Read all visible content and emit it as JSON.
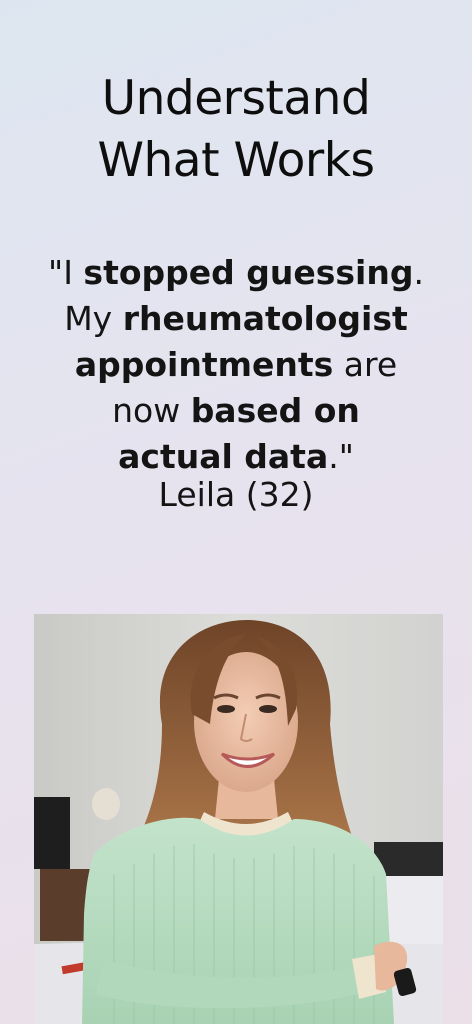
{
  "headline": {
    "line1": "Understand",
    "line2": "What Works"
  },
  "testimonial": {
    "l1_a": "\"I ",
    "l1_b": "stopped guessing",
    "l1_c": ".",
    "l2_a": "My ",
    "l2_b": "rheumatologist",
    "l3_a": "appointments",
    "l3_b": " are",
    "l4_a": "now ",
    "l4_b": "based on",
    "l5_a": "actual data",
    "l5_b": ".\"",
    "author": "Leila (32)"
  },
  "photo": {
    "subject": "smiling woman in mint green sweater in bedroom"
  },
  "colors": {
    "background_top": "#dde6f0",
    "background_bottom": "#ebdfe8",
    "sweater": "#b8dcc0",
    "hair": "#8a5a3a"
  }
}
